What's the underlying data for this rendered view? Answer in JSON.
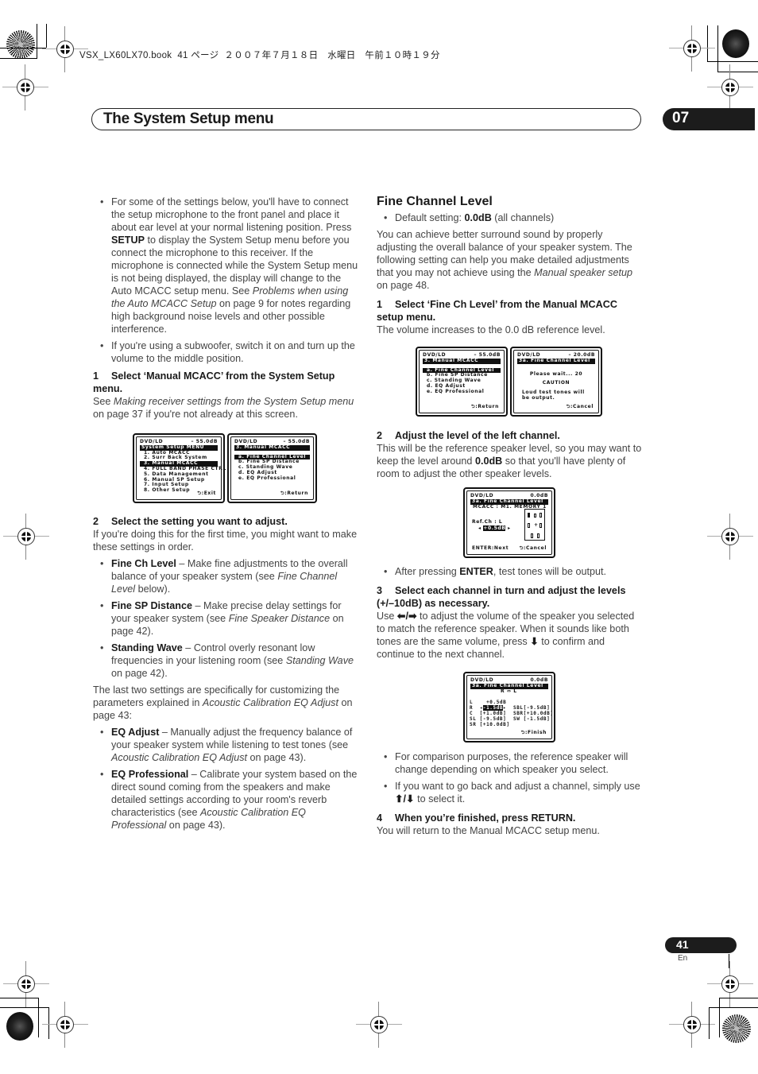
{
  "print_header": {
    "book_line": "VSX_LX60LX70.book  41 ページ  ２００７年７月１８日　水曜日　午前１０時１９分"
  },
  "header": {
    "title": "The System Setup menu",
    "chapter": "07"
  },
  "left_column": {
    "bullets_intro": [
      {
        "pre": "For some of the settings below, you'll have to connect the setup microphone to the front panel and place it about ear level at your normal listening position. Press ",
        "bold": "SETUP",
        "mid": " to display the System Setup menu before you connect the microphone to this receiver. If the microphone is connected while the System Setup menu is not being displayed, the display will change to the Auto MCACC setup menu. See ",
        "italic": "Problems when using the Auto MCACC Setup",
        "post": " on page 9 for notes regarding high background noise levels and other possible interference."
      },
      {
        "text": "If you're using a subwoofer, switch it on and turn up the volume to the middle position."
      }
    ],
    "step1": {
      "num": "1",
      "title": "Select ‘Manual MCACC’ from the System Setup menu.",
      "body_pre": "See ",
      "body_italic": "Making receiver settings from the System Setup menu",
      "body_post": " on page 37 if you're not already at this screen."
    },
    "step2": {
      "num": "2",
      "title": "Select the setting you want to adjust.",
      "body": "If you're doing this for the first time, you might want to make these settings in order."
    },
    "settings_bullets": [
      {
        "bold": "Fine Ch Level",
        "pre": " – Make fine adjustments to the overall balance of your speaker system (see ",
        "italic": "Fine Channel Level",
        "post": " below)."
      },
      {
        "bold": "Fine SP Distance",
        "pre": " – Make precise delay settings for your speaker system (see ",
        "italic": "Fine Speaker Distance",
        "post": " on page 42)."
      },
      {
        "bold": "Standing Wave",
        "pre": " – Control overly resonant low frequencies in your listening room (see ",
        "italic": "Standing Wave",
        "post": " on page 42)."
      }
    ],
    "last_two": {
      "pre": "The last two settings are specifically for customizing the parameters explained in ",
      "italic": "Acoustic Calibration EQ Adjust",
      "post": " on page 43:"
    },
    "eq_bullets": [
      {
        "bold": "EQ Adjust",
        "pre": " – Manually adjust the frequency balance of your speaker system while listening to test tones (see ",
        "italic": "Acoustic Calibration EQ Adjust",
        "post": " on page 43)."
      },
      {
        "bold": "EQ Professional",
        "pre": " – Calibrate your system based on the direct sound coming from the speakers and make detailed settings according to your room's reverb characteristics (see ",
        "italic": "Acoustic Calibration EQ Professional",
        "post": " on page 43)."
      }
    ]
  },
  "right_column": {
    "section_title": "Fine Channel Level",
    "default_bullet": {
      "pre": "Default setting: ",
      "bold": "0.0dB",
      "post": " (all channels)"
    },
    "intro": {
      "pre": "You can achieve better surround sound by properly adjusting the overall balance of your speaker system. The following setting can help you make detailed adjustments that you may not achieve using the ",
      "italic": "Manual speaker setup",
      "post": " on page 48."
    },
    "step1": {
      "num": "1",
      "title": "Select ‘Fine Ch Level’ from the Manual MCACC setup menu.",
      "body": "The volume increases to the 0.0 dB reference level."
    },
    "step2": {
      "num": "2",
      "title": "Adjust the level of the left channel.",
      "body_pre": "This will be the reference speaker level, so you may want to keep the level around ",
      "body_bold": "0.0dB",
      "body_post": " so that you'll have plenty of room to adjust the other speaker levels."
    },
    "enter_bullet": {
      "pre": "After pressing ",
      "bold": "ENTER",
      "post": ", test tones will be output."
    },
    "step3": {
      "num": "3",
      "title": "Select each channel in turn and adjust the levels (+/–10dB) as necessary.",
      "body_pre": "Use ",
      "arrows_lr": "⬅/➡",
      "body_mid": " to adjust the volume of the speaker you selected to match the reference speaker. When it sounds like both tones are the same volume, press ",
      "arrow_down": "⬇",
      "body_post": " to confirm and continue to the next channel."
    },
    "final_bullets": [
      {
        "text": "For comparison purposes, the reference speaker will change depending on which speaker you select."
      },
      {
        "pre": "If you want to go back and adjust a channel, simply use ",
        "arrows": "⬆/⬇",
        "post": " to select it."
      }
    ],
    "step4": {
      "num": "4",
      "title": "When you’re finished, press RETURN.",
      "body": "You will return to the Manual MCACC setup menu."
    }
  },
  "screens": {
    "system_setup": {
      "source": "DVD/LD",
      "volume": "– 55.0dB",
      "title": "System Setup MENU",
      "items": [
        "1. Auto MCACC",
        "2. Surr Back System",
        "3. Manual MCACC",
        "4. FULL BAND PHASE CTRL",
        "5. Data Management",
        "6. Manual SP Setup",
        "7. Input Setup",
        "8. Other Setup"
      ],
      "selected_index": 2,
      "footer": "⮌:Exit"
    },
    "manual_mcacc_a": {
      "source": "DVD/LD",
      "volume": "– 55.0dB",
      "title": "3. Manual MCACC",
      "items": [
        "a. Fine Channel Level",
        "b. Fine SP Distance",
        "c. Standing Wave",
        "d. EQ Adjust",
        "e. EQ Professional"
      ],
      "selected_index": 0,
      "footer": "⮌:Return"
    },
    "manual_mcacc_b": {
      "source": "DVD/LD",
      "volume": "– 55.0dB",
      "title": "3. Manual MCACC",
      "items": [
        "a. Fine Channel Level",
        "b. Fine SP Distance",
        "c. Standing Wave",
        "d. EQ Adjust",
        "e. EQ Professional"
      ],
      "selected_index": 0,
      "footer": "⮌:Return"
    },
    "please_wait": {
      "source": "DVD/LD",
      "volume": "– 20.0dB",
      "title": "3a. Fine Channel Level",
      "wait": "Please wait... 20",
      "caution": "CAUTION",
      "warning_line1": "Loud test tones will",
      "warning_line2": "be output.",
      "footer": "⮌:Cancel"
    },
    "ref_channel": {
      "source": "DVD/LD",
      "volume": "0.0dB",
      "title": "3a. Fine Channel Level",
      "mcacc": "MCACC  : M1. MEMORY 1",
      "ref_label": "Ref.Ch : L",
      "ref_value": "+0.5dB",
      "footer_left": "ENTER:Next",
      "footer": "⮌:Cancel"
    },
    "channel_levels": {
      "source": "DVD/LD",
      "volume": "0.0dB",
      "title": "3a. Fine Channel Level",
      "compare": "R   ⇔   L",
      "left_channels": [
        {
          "ch": "L",
          "value": "+0.5dB"
        },
        {
          "ch": "R",
          "value": "-1.5dB",
          "selected": true
        },
        {
          "ch": "C",
          "value": "+1.0dB"
        },
        {
          "ch": "SL",
          "value": "-9.5dB"
        },
        {
          "ch": "SR",
          "value": "+10.0dB"
        }
      ],
      "right_channels": [
        {
          "ch": "SBL",
          "value": "-9.5dB"
        },
        {
          "ch": "SBR",
          "value": "+10.0dB"
        },
        {
          "ch": "SW",
          "value": "-1.5dB"
        }
      ],
      "footer": "⮌:Finish"
    }
  },
  "footer": {
    "page_number": "41",
    "language": "En"
  }
}
